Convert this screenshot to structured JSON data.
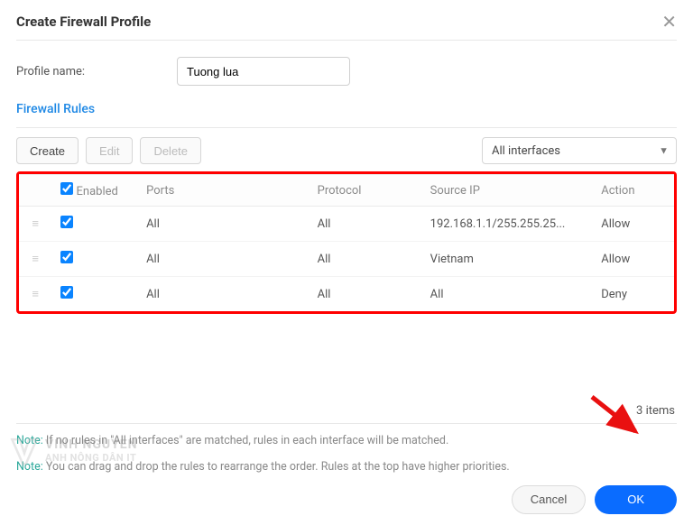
{
  "header": {
    "title": "Create Firewall Profile"
  },
  "form": {
    "profile_name_label": "Profile name:",
    "profile_name_value": "Tuong lua"
  },
  "section": {
    "heading": "Firewall Rules"
  },
  "toolbar": {
    "create": "Create",
    "edit": "Edit",
    "delete": "Delete"
  },
  "interface_select": {
    "value": "All interfaces"
  },
  "table": {
    "headers": {
      "enabled": "Enabled",
      "ports": "Ports",
      "protocol": "Protocol",
      "source": "Source IP",
      "action": "Action"
    },
    "rows": [
      {
        "enabled": true,
        "ports": "All",
        "protocol": "All",
        "source": "192.168.1.1/255.255.25...",
        "action": "Allow"
      },
      {
        "enabled": true,
        "ports": "All",
        "protocol": "All",
        "source": "Vietnam",
        "action": "Allow"
      },
      {
        "enabled": true,
        "ports": "All",
        "protocol": "All",
        "source": "All",
        "action": "Deny"
      }
    ]
  },
  "item_count": "3 items",
  "notes": {
    "label": "Note:",
    "text1": "If no rules in \"All interfaces\" are matched, rules in each interface will be matched.",
    "text2": "You can drag and drop the rules to rearrange the order. Rules at the top have higher priorities."
  },
  "footer": {
    "cancel": "Cancel",
    "ok": "OK"
  },
  "watermark": {
    "line1": "VINH NGUYEN",
    "line2": "ANH NÔNG DÂN IT"
  }
}
